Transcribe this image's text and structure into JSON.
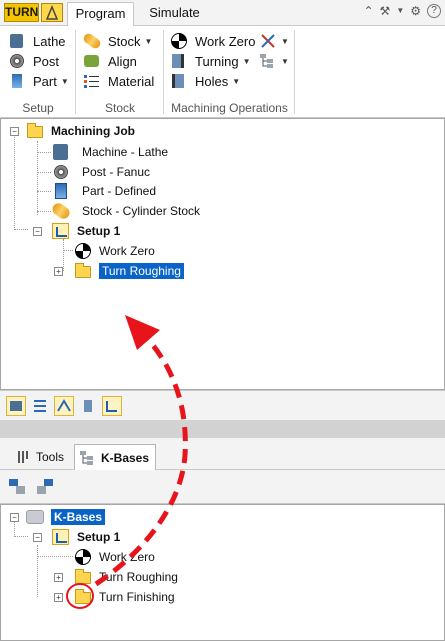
{
  "ribbon": {
    "app_button": "TURN",
    "tabs": [
      {
        "label": "Program",
        "active": true
      },
      {
        "label": "Simulate",
        "active": false
      }
    ],
    "groups": {
      "setup": {
        "label": "Setup",
        "items": {
          "lathe": "Lathe",
          "post": "Post",
          "part": "Part"
        }
      },
      "stock": {
        "label": "Stock",
        "items": {
          "stock": "Stock",
          "align": "Align",
          "material": "Material"
        }
      },
      "machining": {
        "label": "Machining Operations",
        "items": {
          "work_zero": "Work Zero",
          "turning": "Turning",
          "holes": "Holes"
        }
      }
    }
  },
  "job_tree": {
    "root": "Machining Job",
    "items": [
      {
        "label": "Machine - Lathe",
        "icon": "machine-icon"
      },
      {
        "label": "Post - Fanuc",
        "icon": "post-icon"
      },
      {
        "label": "Part - Defined",
        "icon": "part-icon"
      },
      {
        "label": "Stock - Cylinder Stock",
        "icon": "stock-icon"
      }
    ],
    "setup": {
      "label": "Setup 1",
      "children": [
        {
          "label": "Work Zero",
          "icon": "work-zero-icon"
        },
        {
          "label": "Turn Roughing",
          "icon": "folder-icon",
          "selected": true
        }
      ]
    }
  },
  "kbases_panel": {
    "tabs": [
      {
        "label": "Tools",
        "active": false
      },
      {
        "label": "K-Bases",
        "active": true
      }
    ],
    "tree": {
      "root": "K-Bases",
      "setup": {
        "label": "Setup 1",
        "children": [
          {
            "label": "Work Zero",
            "icon": "work-zero-icon"
          },
          {
            "label": "Turn Roughing",
            "icon": "folder-icon"
          },
          {
            "label": "Turn Finishing",
            "icon": "folder-icon",
            "highlighted": true
          }
        ]
      }
    }
  },
  "colors": {
    "selection": "#0a64c8",
    "annotation_arrow": "#e8141c",
    "turn_button": "#f5c400"
  }
}
